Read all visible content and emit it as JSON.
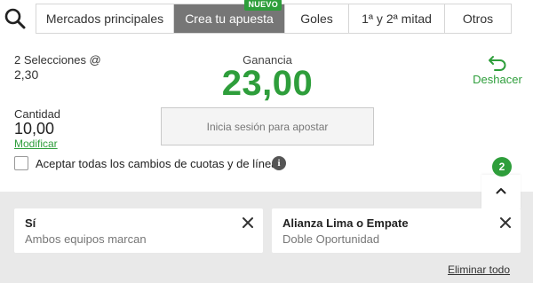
{
  "header": {
    "search_icon": "search-icon",
    "tabs": [
      {
        "label": "Mercados principales",
        "active": false
      },
      {
        "label": "Crea tu apuesta",
        "active": true,
        "badge": "NUEVO"
      },
      {
        "label": "Goles",
        "active": false
      },
      {
        "label": "1ª y 2ª mitad",
        "active": false
      },
      {
        "label": "Otros",
        "active": false
      }
    ]
  },
  "slip": {
    "selections_label": "2 Selecciones @",
    "odds": "2,30",
    "gain_label": "Ganancia",
    "gain_value": "23,00",
    "undo_icon": "undo-arrow-icon",
    "undo_label": "Deshacer",
    "quantity_label": "Cantidad",
    "quantity_value": "10,00",
    "modify_label": "Modificar",
    "login_button": "Inicia sesión para apostar",
    "accept_changes_label": "Aceptar todas los cambios de cuotas y de líneas",
    "accept_changes_checked": false,
    "info_icon_glyph": "i"
  },
  "selections_panel": {
    "count": "2",
    "collapse_icon": "chevron-up-icon",
    "items": [
      {
        "title": "Sí",
        "subtitle": "Ambos equipos marcan"
      },
      {
        "title": "Alianza Lima o Empate",
        "subtitle": "Doble Oportunidad"
      }
    ],
    "remove_all_label": "Eliminar todo"
  },
  "colors": {
    "accent_green": "#2e9e3b",
    "active_tab_bg": "#767676",
    "panel_bg": "#e9e9e9"
  }
}
